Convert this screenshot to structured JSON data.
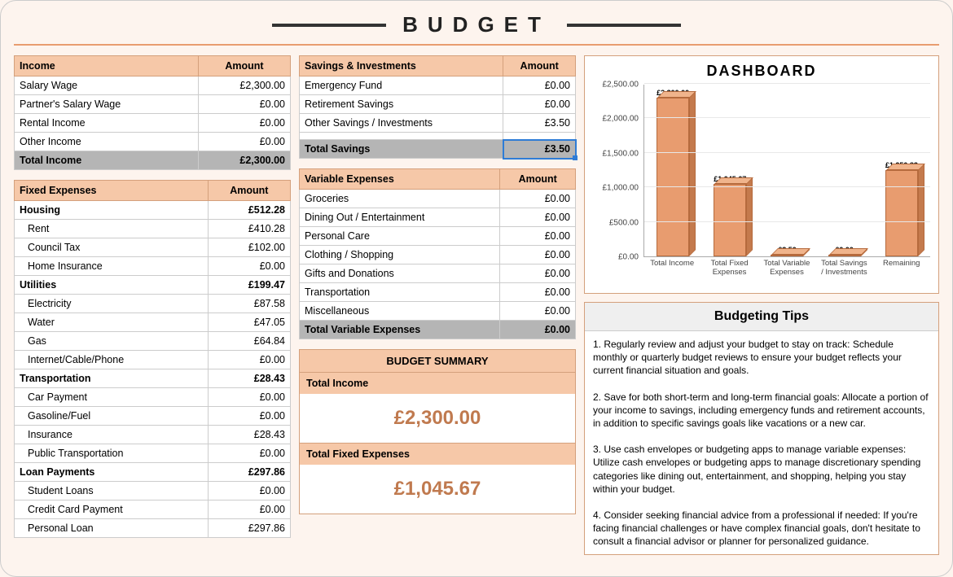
{
  "title": "BUDGET",
  "headers": {
    "income_col1": "Income",
    "amount": "Amount",
    "savings_col1": "Savings & Investments",
    "fixed_col1": "Fixed Expenses",
    "variable_col1": "Variable Expenses"
  },
  "income": {
    "rows": [
      {
        "label": "Salary Wage",
        "value": "£2,300.00"
      },
      {
        "label": "Partner's Salary Wage",
        "value": "£0.00"
      },
      {
        "label": "Rental Income",
        "value": "£0.00"
      },
      {
        "label": "Other Income",
        "value": "£0.00"
      }
    ],
    "total_label": "Total Income",
    "total_value": "£2,300.00"
  },
  "savings": {
    "rows": [
      {
        "label": "Emergency Fund",
        "value": "£0.00"
      },
      {
        "label": "Retirement Savings",
        "value": "£0.00"
      },
      {
        "label": "Other Savings / Investments",
        "value": "£3.50"
      },
      {
        "label": "",
        "value": ""
      }
    ],
    "total_label": "Total Savings",
    "total_value": "£3.50"
  },
  "fixed": {
    "groups": [
      {
        "cat": "Housing",
        "cat_val": "£512.28",
        "subs": [
          {
            "label": "Rent",
            "value": "£410.28"
          },
          {
            "label": "Council Tax",
            "value": "£102.00"
          },
          {
            "label": "Home Insurance",
            "value": "£0.00"
          }
        ]
      },
      {
        "cat": "Utilities",
        "cat_val": "£199.47",
        "subs": [
          {
            "label": "Electricity",
            "value": "£87.58"
          },
          {
            "label": "Water",
            "value": "£47.05"
          },
          {
            "label": "Gas",
            "value": "£64.84"
          },
          {
            "label": "Internet/Cable/Phone",
            "value": "£0.00"
          }
        ]
      },
      {
        "cat": "Transportation",
        "cat_val": "£28.43",
        "subs": [
          {
            "label": "Car Payment",
            "value": "£0.00"
          },
          {
            "label": "Gasoline/Fuel",
            "value": "£0.00"
          },
          {
            "label": "Insurance",
            "value": "£28.43"
          },
          {
            "label": "Public Transportation",
            "value": "£0.00"
          }
        ]
      },
      {
        "cat": "Loan Payments",
        "cat_val": "£297.86",
        "subs": [
          {
            "label": "Student Loans",
            "value": "£0.00"
          },
          {
            "label": "Credit Card Payment",
            "value": "£0.00"
          },
          {
            "label": "Personal Loan",
            "value": "£297.86"
          }
        ]
      }
    ]
  },
  "variable": {
    "rows": [
      {
        "label": "Groceries",
        "value": "£0.00"
      },
      {
        "label": "Dining Out / Entertainment",
        "value": "£0.00"
      },
      {
        "label": "Personal Care",
        "value": "£0.00"
      },
      {
        "label": "Clothing / Shopping",
        "value": "£0.00"
      },
      {
        "label": "Gifts and Donations",
        "value": "£0.00"
      },
      {
        "label": "Transportation",
        "value": "£0.00"
      },
      {
        "label": "Miscellaneous",
        "value": "£0.00"
      }
    ],
    "total_label": "Total Variable Expenses",
    "total_value": "£0.00"
  },
  "summary": {
    "title": "BUDGET SUMMARY",
    "rows": [
      {
        "label": "Total Income",
        "value": "£2,300.00"
      },
      {
        "label": "Total Fixed Expenses",
        "value": "£1,045.67"
      }
    ]
  },
  "dashboard_title": "DASHBOARD",
  "tips_title": "Budgeting Tips",
  "tips": [
    "1. Regularly review and adjust your budget to stay on track: Schedule monthly or quarterly budget reviews to ensure your budget reflects your current financial situation and goals.",
    "2. Save for both short-term and long-term financial goals: Allocate a portion of your income to savings, including emergency funds and retirement accounts, in addition to specific savings goals like vacations or a new car.",
    "3. Use cash envelopes or budgeting apps to manage variable expenses: Utilize cash envelopes or budgeting apps to manage discretionary spending categories like dining out, entertainment, and shopping, helping you stay within your budget.",
    "4. Consider seeking financial advice from a professional if needed: If you're facing financial challenges or have complex financial goals, don't hesitate to consult a financial advisor or planner for personalized guidance."
  ],
  "chart_data": {
    "type": "bar",
    "title": "DASHBOARD",
    "ylabel": "",
    "ylim": [
      0,
      2500
    ],
    "yticks": [
      "£0.00",
      "£500.00",
      "£1,000.00",
      "£1,500.00",
      "£2,000.00",
      "£2,500.00"
    ],
    "categories": [
      "Total Income",
      "Total Fixed Expenses",
      "Total Variable Expenses",
      "Total Savings / Investments",
      "Remaining"
    ],
    "values": [
      2300.0,
      1045.67,
      3.5,
      0.0,
      1250.83
    ],
    "value_labels": [
      "£2,300.00",
      "£1,045.67",
      "£3.50",
      "£0.00",
      "£1,250.83"
    ]
  }
}
